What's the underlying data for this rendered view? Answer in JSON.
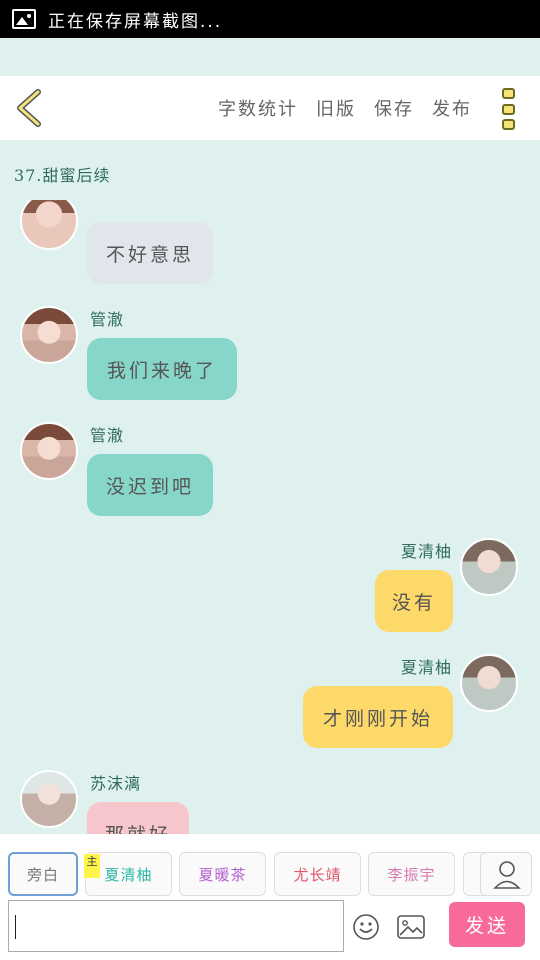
{
  "status_bar": {
    "text": "正在保存屏幕截图..."
  },
  "toolbar": {
    "word_count": "字数统计",
    "old_version": "旧版",
    "save": "保存",
    "publish": "发布"
  },
  "chapter_title": "37.甜蜜后续",
  "messages": [
    {
      "side": "left",
      "name": "",
      "text": "不好意思",
      "color": "#e1e5ec"
    },
    {
      "side": "left",
      "name": "管澈",
      "text": "我们来晚了",
      "color": "#87d6ca"
    },
    {
      "side": "left",
      "name": "管澈",
      "text": "没迟到吧",
      "color": "#87d6ca"
    },
    {
      "side": "right",
      "name": "夏清柚",
      "text": "没有",
      "color": "#fdd96a"
    },
    {
      "side": "right",
      "name": "夏清柚",
      "text": "才刚刚开始",
      "color": "#fdd96a"
    },
    {
      "side": "left",
      "name": "苏沫漓",
      "text": "那就好",
      "color": "#f7c6cc"
    }
  ],
  "characters": [
    {
      "label": "旁白",
      "color": "#777777"
    },
    {
      "label": "夏清柚",
      "color": "#2cb9a6"
    },
    {
      "label": "夏暖茶",
      "color": "#b35fd0"
    },
    {
      "label": "尤长靖",
      "color": "#e0556a"
    },
    {
      "label": "李振宇",
      "color": "#d67ab0"
    }
  ],
  "main_badge": "主",
  "input": {
    "value": ""
  },
  "send_label": "发送"
}
